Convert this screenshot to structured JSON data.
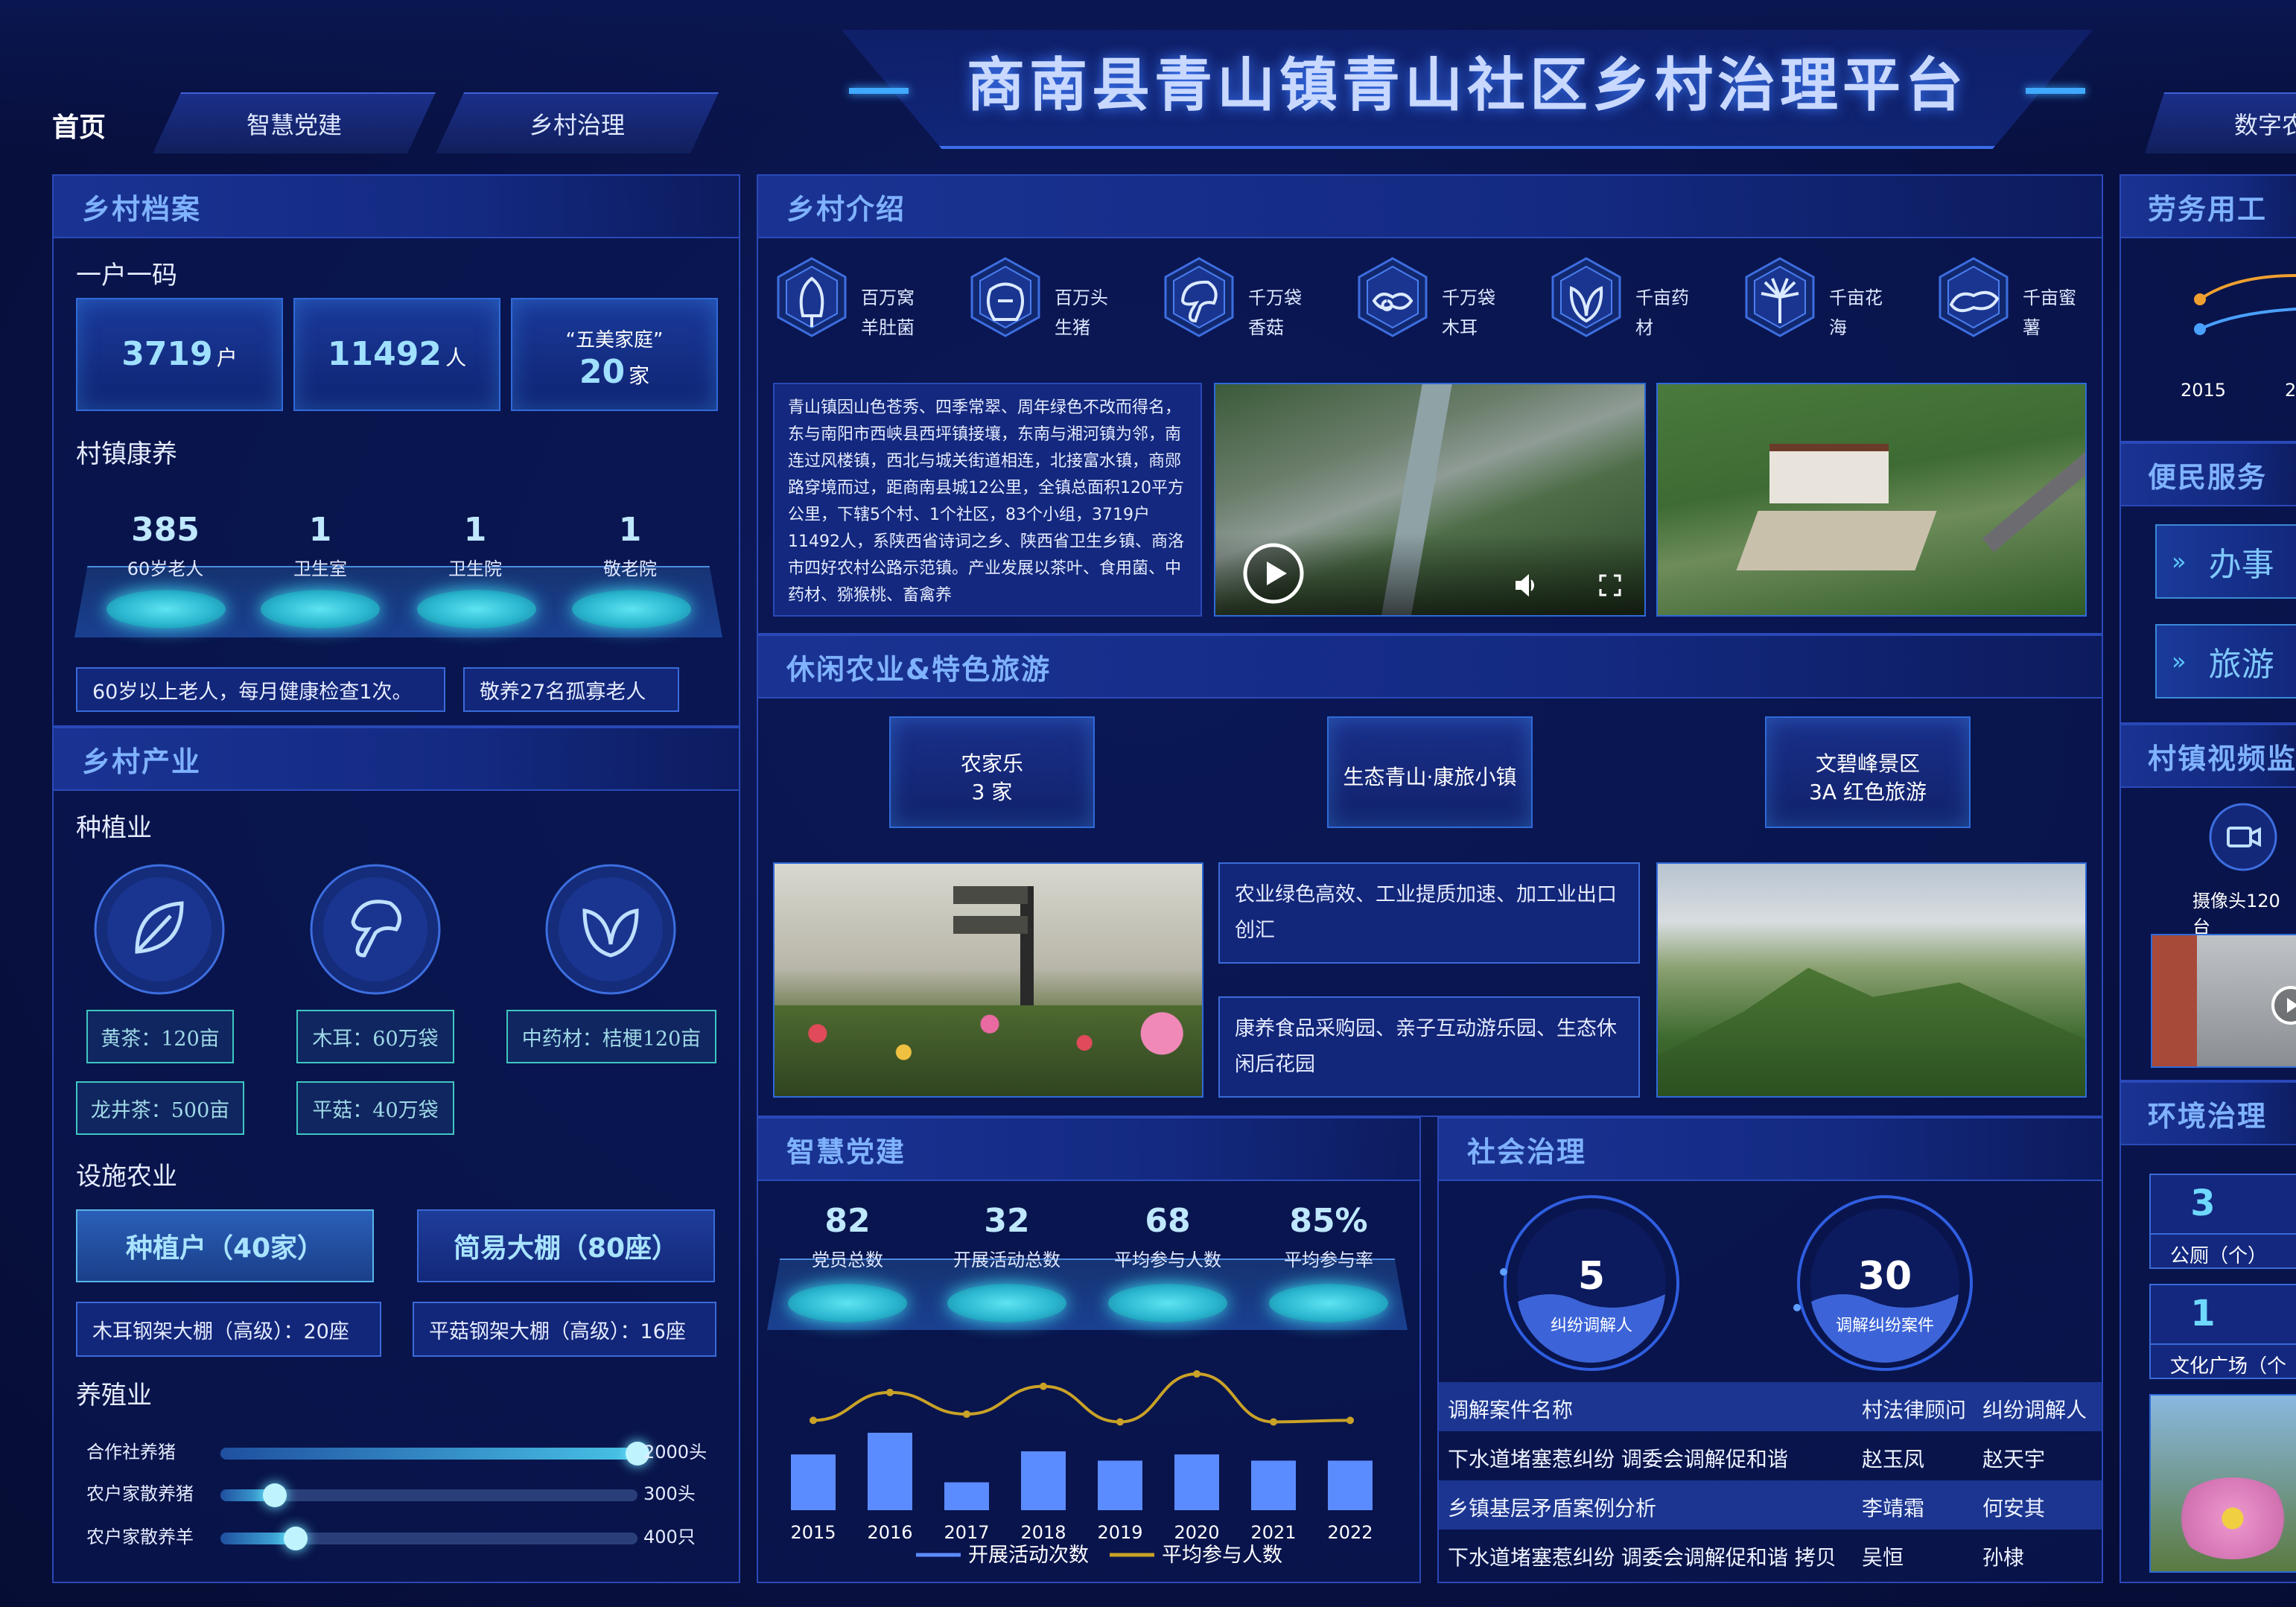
{
  "title": "商南县青山镇青山社区乡村治理平台",
  "nav": {
    "home": "首页",
    "tab1": "智慧党建",
    "tab2": "乡村治理",
    "tab3": "数字农"
  },
  "archive": {
    "title": "乡村档案",
    "code_label": "一户一码",
    "households_value": "3719",
    "households_unit": "户",
    "people_value": "11492",
    "people_unit": "人",
    "family_label": "“五美家庭”",
    "family_value": "20",
    "family_unit": "家",
    "care_label": "村镇康养",
    "stats": [
      {
        "value": "385",
        "label": "60岁老人"
      },
      {
        "value": "1",
        "label": "卫生室"
      },
      {
        "value": "1",
        "label": "卫生院"
      },
      {
        "value": "1",
        "label": "敬老院"
      }
    ],
    "note1": "60岁以上老人，每月健康检查1次。",
    "note2": "敬养27名孤寡老人"
  },
  "industry": {
    "title": "乡村产业",
    "planting": "种植业",
    "tags": [
      "黄茶：120亩",
      "木耳：60万袋",
      "中药材：桔梗120亩",
      "龙井茶：500亩",
      "平菇：40万袋"
    ],
    "facility": "设施农业",
    "btn1": "种植户（40家）",
    "btn2": "简易大棚（80座）",
    "info1": "木耳钢架大棚（高级）：20座",
    "info2": "平菇钢架大棚（高级）：16座",
    "breeding": "养殖业",
    "farms": [
      {
        "label": "合作社养猪",
        "value": "2000头",
        "level": 1.0
      },
      {
        "label": "农户家散养猪",
        "value": "300头",
        "level": 0.13
      },
      {
        "label": "农户家散养羊",
        "value": "400只",
        "level": 0.18
      }
    ]
  },
  "intro": {
    "title": "乡村介绍",
    "icons": [
      {
        "l1": "百万窝",
        "l2": "羊肚菌",
        "icon": "morel-icon"
      },
      {
        "l1": "百万头",
        "l2": "生猪",
        "icon": "pig-icon"
      },
      {
        "l1": "千万袋",
        "l2": "香菇",
        "icon": "mushroom-icon"
      },
      {
        "l1": "千万袋",
        "l2": "木耳",
        "icon": "fungus-icon"
      },
      {
        "l1": "千亩药",
        "l2": "材",
        "icon": "herb-leaf-icon"
      },
      {
        "l1": "千亩花",
        "l2": "海",
        "icon": "flower-icon"
      },
      {
        "l1": "千亩蜜",
        "l2": "薯",
        "icon": "sweet-potato-icon"
      }
    ],
    "text": "青山镇因山色苍秀、四季常翠、周年绿色不改而得名，东与南阳市西峡县西坪镇接壤，东南与湘河镇为邻，南连过风楼镇，西北与城关街道相连，北接富水镇，商郧路穿境而过，距商南县城12公里，全镇总面积120平方公里，下辖5个村、1个社区，83个小组，3719户11492人，系陕西省诗词之乡、陕西省卫生乡镇、商洛市四好农村公路示范镇。产业发展以茶叶、食用菌、中药材、猕猴桃、畜禽养"
  },
  "leisure": {
    "title": "休闲农业&特色旅游",
    "card1_l1": "农家乐",
    "card1_l2": "3  家",
    "card2": "生态青山·康旅小镇",
    "card3_l1": "文碧峰景区",
    "card3_l2": "3A  红色旅游",
    "box1": "农业绿色高效、工业提质加速、加工业出口 创汇",
    "box2": "康养食品采购园、亲子互动游乐园、生态休 闲后花园"
  },
  "party": {
    "title": "智慧党建",
    "stats": [
      {
        "value": "82",
        "label": "党员总数"
      },
      {
        "value": "32",
        "label": "开展活动总数"
      },
      {
        "value": "68",
        "label": "平均参与人数"
      },
      {
        "value": "85%",
        "label": "平均参与率"
      }
    ]
  },
  "chart_data": {
    "type": "bar",
    "categories": [
      "2015",
      "2016",
      "2017",
      "2018",
      "2019",
      "2020",
      "2021",
      "2022"
    ],
    "series": [
      {
        "name": "开展活动次数",
        "type": "bar",
        "values": [
          36,
          50,
          18,
          38,
          32,
          36,
          32,
          32
        ],
        "color": "#5b8cff"
      },
      {
        "name": "平均参与人数",
        "type": "line",
        "values": [
          58,
          76,
          62,
          80,
          57,
          88,
          57,
          58
        ],
        "color": "#c9a227"
      }
    ],
    "ylim": [
      0,
      100
    ]
  },
  "governance": {
    "title": "社会治理",
    "g1_value": "5",
    "g1_label": "纠纷调解人",
    "g2_value": "30",
    "g2_label": "调解纠纷案件",
    "headers": [
      "调解案件名称",
      "村法律顾问",
      "纠纷调解人"
    ],
    "rows": [
      [
        "下水道堵塞惹纠纷 调委会调解促和谐",
        "赵玉凤",
        "赵天宇"
      ],
      [
        "乡镇基层矛盾案例分析",
        "李靖霜",
        "何安其"
      ],
      [
        "下水道堵塞惹纠纷 调委会调解促和谐 拷贝",
        "吴恒",
        "孙棣"
      ]
    ]
  },
  "right": {
    "labor_title": "劳务用工",
    "years": [
      "2015",
      "2"
    ],
    "service_title": "便民服务",
    "svc1": "办事",
    "svc2": "旅游",
    "video_title": "村镇视频监",
    "camera": "摄像头120台",
    "env_title": "环境治理",
    "env1_value": "3",
    "env1_label": "公厕（个）",
    "env2_value": "1",
    "env2_label": "文化广场（个"
  },
  "colors": {
    "accent": "#7fb2ff",
    "panel_border": "#2a49b8",
    "teal": "#3ec7c0",
    "bar": "#5b8cff",
    "line": "#c9a227"
  }
}
